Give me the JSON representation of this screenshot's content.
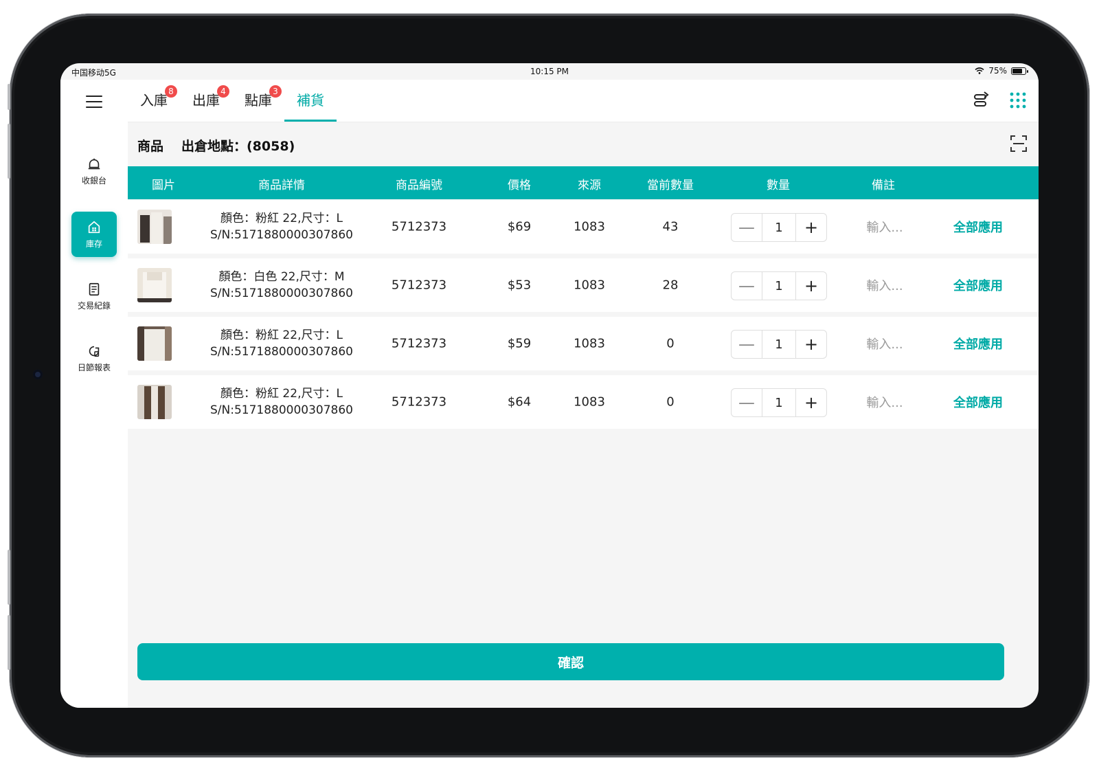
{
  "statusbar": {
    "carrier": "中国移动5G",
    "time": "10:15 PM",
    "battery": "75%"
  },
  "sidebar": {
    "items": [
      {
        "label": "收銀台",
        "icon": "bell-icon"
      },
      {
        "label": "庫存",
        "icon": "store-icon",
        "active": true
      },
      {
        "label": "交易紀錄",
        "icon": "document-icon"
      },
      {
        "label": "日節報表",
        "icon": "report-icon"
      }
    ]
  },
  "tabs": [
    {
      "label": "入庫",
      "badge": "8"
    },
    {
      "label": "出庫",
      "badge": "4"
    },
    {
      "label": "點庫",
      "badge": "3"
    },
    {
      "label": "補貨",
      "active": true
    }
  ],
  "subheader": {
    "title": "商品",
    "location": "出倉地點：(8058)"
  },
  "table": {
    "headers": [
      "圖片",
      "商品詳情",
      "商品編號",
      "價格",
      "來源",
      "當前數量",
      "數量",
      "備註"
    ],
    "rows": [
      {
        "detail_line1": "顏色：粉紅 22,尺寸：L",
        "detail_line2": "S/N:5171880000307860",
        "code": "5712373",
        "price": "$69",
        "source": "1083",
        "current": "43",
        "qty": "1",
        "note": "輸入...",
        "apply": "全部應用"
      },
      {
        "detail_line1": "顏色：白色 22,尺寸：M",
        "detail_line2": "S/N:5171880000307860",
        "code": "5712373",
        "price": "$53",
        "source": "1083",
        "current": "28",
        "qty": "1",
        "note": "輸入...",
        "apply": "全部應用"
      },
      {
        "detail_line1": "顏色：粉紅 22,尺寸：L",
        "detail_line2": "S/N:5171880000307860",
        "code": "5712373",
        "price": "$59",
        "source": "1083",
        "current": "0",
        "qty": "1",
        "note": "輸入...",
        "apply": "全部應用"
      },
      {
        "detail_line1": "顏色：粉紅 22,尺寸：L",
        "detail_line2": "S/N:5171880000307860",
        "code": "5712373",
        "price": "$64",
        "source": "1083",
        "current": "0",
        "qty": "1",
        "note": "輸入...",
        "apply": "全部應用"
      }
    ]
  },
  "confirm_label": "確認",
  "colors": {
    "accent": "#00b0ad",
    "badge": "#f04b4b"
  }
}
